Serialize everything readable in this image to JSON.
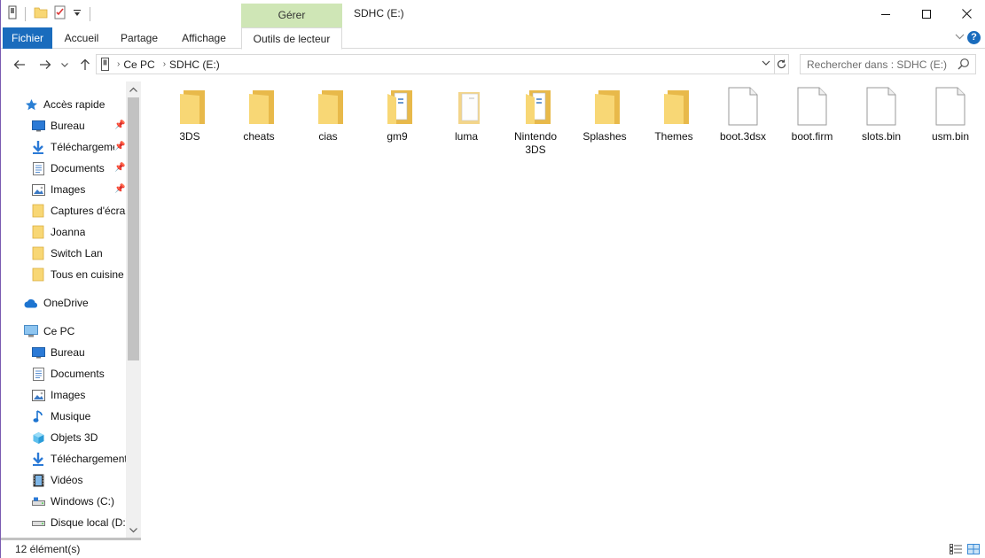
{
  "window": {
    "title": "SDHC (E:)",
    "manage_tab": "Gérer",
    "controls": {
      "minimize": "minimize-icon",
      "maximize": "maximize-icon",
      "close": "close-icon"
    }
  },
  "ribbon": {
    "tabs": [
      "Fichier",
      "Accueil",
      "Partage",
      "Affichage",
      "Outils de lecteur"
    ],
    "help": "?"
  },
  "address": {
    "segments": [
      "Ce PC",
      "SDHC (E:)"
    ],
    "search_placeholder": "Rechercher dans : SDHC (E:)"
  },
  "sidebar": {
    "quick_access": "Accès rapide",
    "quick_items": [
      {
        "label": "Bureau",
        "icon": "desktop-icon",
        "pinned": true
      },
      {
        "label": "Téléchargements",
        "icon": "download-icon",
        "pinned": true
      },
      {
        "label": "Documents",
        "icon": "documents-icon",
        "pinned": true
      },
      {
        "label": "Images",
        "icon": "images-icon",
        "pinned": true
      },
      {
        "label": "Captures d'écran",
        "icon": "folder-icon",
        "pinned": false
      },
      {
        "label": "Joanna",
        "icon": "folder-icon",
        "pinned": false
      },
      {
        "label": "Switch Lan",
        "icon": "folder-icon",
        "pinned": false
      },
      {
        "label": "Tous en cuisine",
        "icon": "folder-icon",
        "pinned": false
      }
    ],
    "onedrive": "OneDrive",
    "this_pc": "Ce PC",
    "pc_items": [
      {
        "label": "Bureau",
        "icon": "desktop-icon"
      },
      {
        "label": "Documents",
        "icon": "documents-icon"
      },
      {
        "label": "Images",
        "icon": "images-icon"
      },
      {
        "label": "Musique",
        "icon": "music-icon"
      },
      {
        "label": "Objets 3D",
        "icon": "cube-icon"
      },
      {
        "label": "Téléchargements",
        "icon": "download-icon"
      },
      {
        "label": "Vidéos",
        "icon": "video-icon"
      },
      {
        "label": "Windows (C:)",
        "icon": "drive-icon"
      },
      {
        "label": "Disque local (D:)",
        "icon": "drive-icon"
      }
    ]
  },
  "files": [
    {
      "name": "3DS",
      "type": "folder"
    },
    {
      "name": "cheats",
      "type": "folder"
    },
    {
      "name": "cias",
      "type": "folder"
    },
    {
      "name": "gm9",
      "type": "folder-docs"
    },
    {
      "name": "luma",
      "type": "folder-open"
    },
    {
      "name": "Nintendo 3DS",
      "type": "folder-docs"
    },
    {
      "name": "Splashes",
      "type": "folder"
    },
    {
      "name": "Themes",
      "type": "folder"
    },
    {
      "name": "boot.3dsx",
      "type": "file"
    },
    {
      "name": "boot.firm",
      "type": "file"
    },
    {
      "name": "slots.bin",
      "type": "file"
    },
    {
      "name": "usm.bin",
      "type": "file"
    }
  ],
  "status": {
    "count": "12 élément(s)"
  },
  "colors": {
    "accent": "#1a6cbd",
    "manage_tab_bg": "#cfe6b6",
    "folder": "#f8d775"
  }
}
